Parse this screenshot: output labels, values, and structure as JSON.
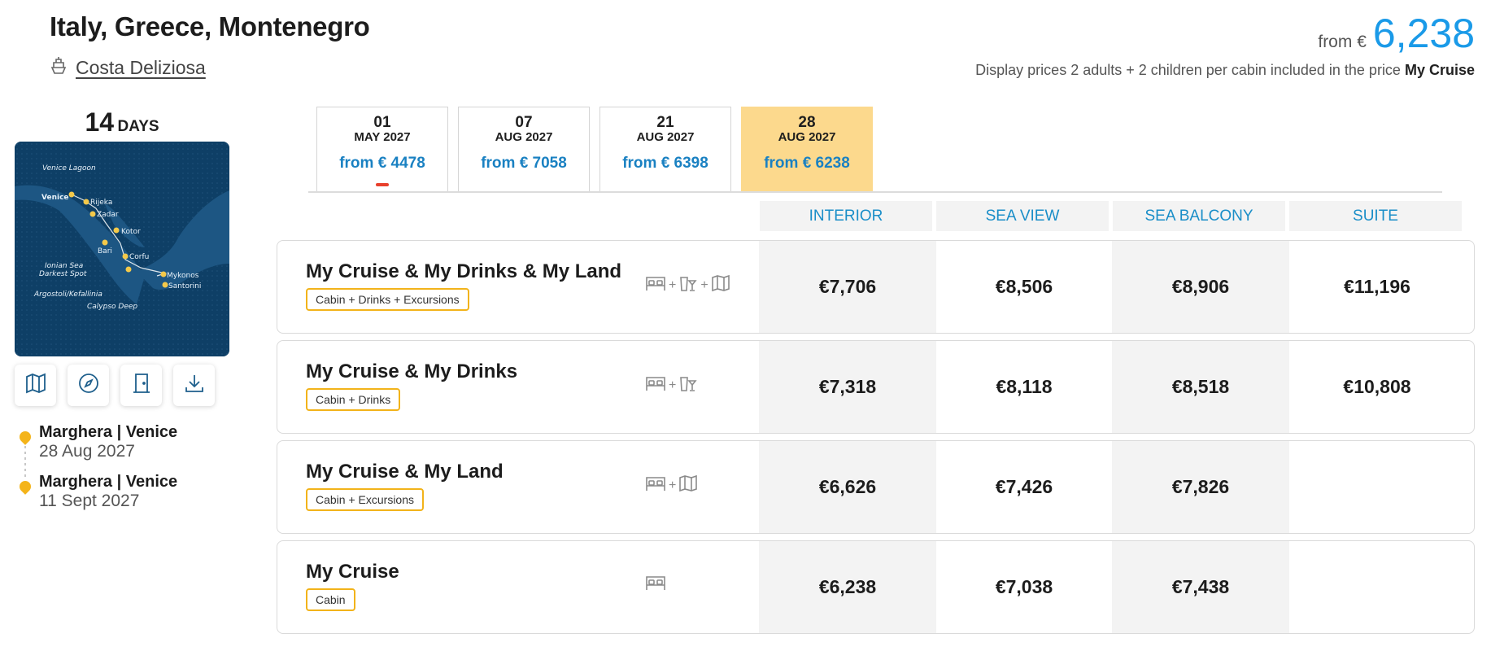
{
  "header": {
    "title": "Italy, Greece, Montenegro",
    "ship_name": "Costa Deliziosa",
    "price_from_label": "from €",
    "price_from_value": "6,238",
    "price_note_prefix": "Display prices 2 adults + 2 children per cabin included in the price",
    "price_note_bold": "My Cruise"
  },
  "duration": {
    "number": "14",
    "unit": "DAYS"
  },
  "map": {
    "labels": {
      "venice_lagoon": "Venice Lagoon",
      "venice": "Venice",
      "rijeka": "Rijeka",
      "zadar": "Zadar",
      "kotor": "Kotor",
      "bari": "Bari",
      "corfu": "Corfu",
      "ionian": "Ionian Sea",
      "darkest": "Darkest Spot",
      "argostoli": "Argostoli/Kefallinia",
      "calypso": "Calypso Deep",
      "mykonos": "Mykonos",
      "santorini": "Santorini"
    },
    "buttons": [
      "map-icon",
      "compass-icon",
      "door-icon",
      "download-icon"
    ]
  },
  "itinerary": [
    {
      "port": "Marghera | Venice",
      "date": "28 Aug 2027"
    },
    {
      "port": "Marghera | Venice",
      "date": "11 Sept 2027"
    }
  ],
  "date_tabs": [
    {
      "day": "01",
      "month": "MAY 2027",
      "price": "from € 4478",
      "active": false,
      "marked": true
    },
    {
      "day": "07",
      "month": "AUG 2027",
      "price": "from € 7058",
      "active": false,
      "marked": false
    },
    {
      "day": "21",
      "month": "AUG 2027",
      "price": "from € 6398",
      "active": false,
      "marked": false
    },
    {
      "day": "28",
      "month": "AUG 2027",
      "price": "from € 6238",
      "active": true,
      "marked": false
    }
  ],
  "columns": [
    "INTERIOR",
    "SEA VIEW",
    "SEA BALCONY",
    "SUITE"
  ],
  "packages": [
    {
      "name": "My Cruise & My Drinks & My Land",
      "tag": "Cabin + Drinks + Excursions",
      "icons": [
        "bed-icon",
        "drinks-icon",
        "excursion-map-icon"
      ],
      "prices": [
        "€7,706",
        "€8,506",
        "€8,906",
        "€11,196"
      ]
    },
    {
      "name": "My Cruise & My Drinks",
      "tag": "Cabin + Drinks",
      "icons": [
        "bed-icon",
        "drinks-icon"
      ],
      "prices": [
        "€7,318",
        "€8,118",
        "€8,518",
        "€10,808"
      ]
    },
    {
      "name": "My Cruise & My Land",
      "tag": "Cabin + Excursions",
      "icons": [
        "bed-icon",
        "excursion-map-icon"
      ],
      "prices": [
        "€6,626",
        "€7,426",
        "€7,826",
        ""
      ]
    },
    {
      "name": "My Cruise",
      "tag": "Cabin",
      "icons": [
        "bed-icon"
      ],
      "prices": [
        "€6,238",
        "€7,038",
        "€7,438",
        ""
      ]
    }
  ],
  "colors": {
    "accent_blue": "#1a9ae8",
    "tab_active": "#fcd98d",
    "tag_border": "#f2b31a",
    "pin": "#f4b41a"
  }
}
